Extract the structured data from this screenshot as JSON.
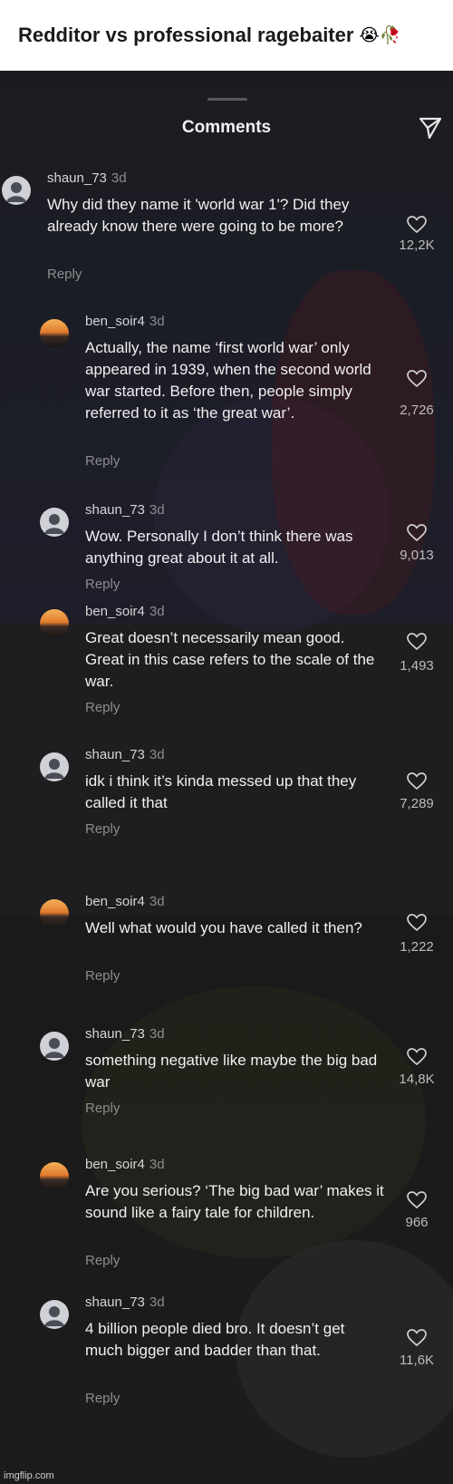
{
  "header": {
    "title": "Redditor vs professional ragebaiter",
    "emojis": "😭🥀"
  },
  "sheet": {
    "title": "Comments",
    "send_icon": "send-icon"
  },
  "comments": [
    {
      "user": "shaun_73",
      "age": "3d",
      "avatar": "default-avatar",
      "text": "Why did they name it 'world war 1'? Did they already know there were going to be more?",
      "likes": "12,2K",
      "reply": "Reply"
    },
    {
      "user": "ben_soir4",
      "age": "3d",
      "avatar": "sunset-avatar",
      "text": "Actually, the name ‘first world war’ only appeared in 1939, when the second world war started. Before then, people simply referred to it as ‘the great war’.",
      "likes": "2,726",
      "reply": "Reply"
    },
    {
      "user": "shaun_73",
      "age": "3d",
      "avatar": "default-avatar",
      "text": "Wow. Personally I don’t think there was anything great about it at all.",
      "likes": "9,013",
      "reply": "Reply"
    },
    {
      "user": "ben_soir4",
      "age": "3d",
      "avatar": "sunset-avatar",
      "text": "Great doesn’t necessarily mean good. Great in this case refers to the scale of the war.",
      "likes": "1,493",
      "reply": "Reply"
    },
    {
      "user": "shaun_73",
      "age": "3d",
      "avatar": "default-avatar",
      "text": "idk i think it’s kinda messed up that they called it that",
      "likes": "7,289",
      "reply": "Reply"
    },
    {
      "user": "ben_soir4",
      "age": "3d",
      "avatar": "sunset-avatar",
      "text": "Well what would you have called it then?",
      "likes": "1,222",
      "reply": "Reply"
    },
    {
      "user": "shaun_73",
      "age": "3d",
      "avatar": "default-avatar",
      "text": "something negative like maybe the big bad war",
      "likes": "14,8K",
      "reply": "Reply"
    },
    {
      "user": "ben_soir4",
      "age": "3d",
      "avatar": "sunset-avatar",
      "text": "Are you serious? ‘The big bad war’ makes it sound like a fairy tale for children.",
      "likes": "966",
      "reply": "Reply"
    },
    {
      "user": "shaun_73",
      "age": "3d",
      "avatar": "default-avatar",
      "text": "4 billion people died bro. It doesn’t get much bigger and badder than that.",
      "likes": "11,6K",
      "reply": "Reply"
    }
  ],
  "watermark": "imgflip.com"
}
